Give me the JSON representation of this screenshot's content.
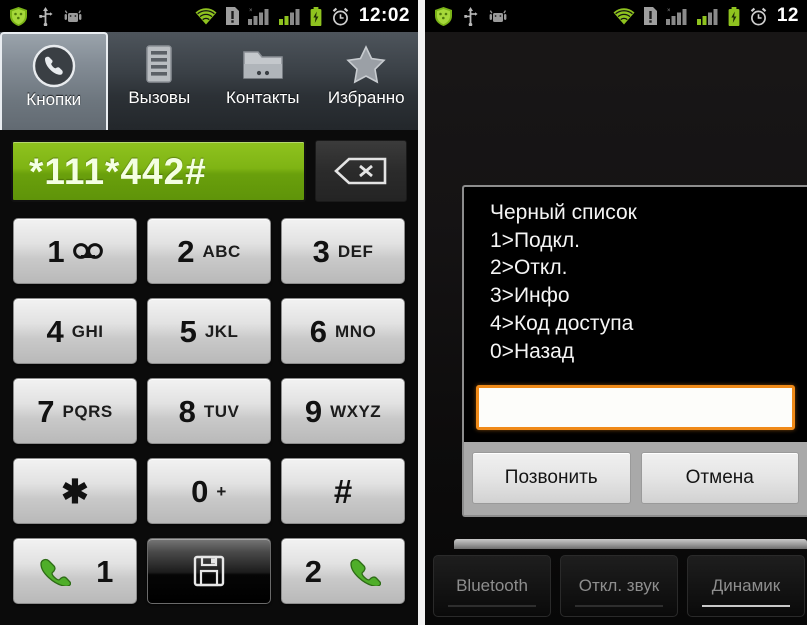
{
  "left_panel": {
    "statusbar": {
      "left_icons": [
        "shield-icon",
        "usb-icon",
        "android-debug-icon"
      ],
      "right_icons": [
        "wifi-icon",
        "sim-alert-icon",
        "signal-bars-gray-icon",
        "signal-bars-green-icon",
        "battery-icon",
        "alarm-clock-icon"
      ],
      "clock": "12:02"
    },
    "tabs": [
      {
        "label": "Кнопки",
        "icon": "phone-handset-icon",
        "active": true
      },
      {
        "label": "Вызовы",
        "icon": "call-log-list-icon",
        "active": false
      },
      {
        "label": "Контакты",
        "icon": "contacts-folder-icon",
        "active": false
      },
      {
        "label": "Избранно",
        "icon": "star-icon",
        "active": false
      }
    ],
    "dialer": {
      "entered_number": "*111*442#",
      "backspace_icon": "backspace-icon"
    },
    "keypad": [
      {
        "num": "1",
        "sub": "",
        "symbol": "",
        "icon": "voicemail-icon",
        "style": "light"
      },
      {
        "num": "2",
        "sub": "ABC",
        "symbol": "",
        "icon": "",
        "style": "light"
      },
      {
        "num": "3",
        "sub": "DEF",
        "symbol": "",
        "icon": "",
        "style": "light"
      },
      {
        "num": "4",
        "sub": "GHI",
        "symbol": "",
        "icon": "",
        "style": "light"
      },
      {
        "num": "5",
        "sub": "JKL",
        "symbol": "",
        "icon": "",
        "style": "light"
      },
      {
        "num": "6",
        "sub": "MNO",
        "symbol": "",
        "icon": "",
        "style": "light"
      },
      {
        "num": "7",
        "sub": "PQRS",
        "symbol": "",
        "icon": "",
        "style": "light"
      },
      {
        "num": "8",
        "sub": "TUV",
        "symbol": "",
        "icon": "",
        "style": "light"
      },
      {
        "num": "9",
        "sub": "WXYZ",
        "symbol": "",
        "icon": "",
        "style": "light"
      },
      {
        "num": "",
        "sub": "",
        "symbol": "✱",
        "icon": "",
        "style": "light"
      },
      {
        "num": "0",
        "sub": "+",
        "symbol": "",
        "icon": "",
        "style": "light"
      },
      {
        "num": "",
        "sub": "",
        "symbol": "#",
        "icon": "",
        "style": "light"
      }
    ],
    "action_row": {
      "call_sim1_label": "1",
      "call_sim1_icon": "green-handset-icon",
      "save_icon": "floppy-save-icon",
      "call_sim2_label": "2",
      "call_sim2_icon": "green-handset-icon"
    }
  },
  "right_panel": {
    "statusbar": {
      "left_icons": [
        "shield-icon",
        "usb-icon",
        "android-debug-icon"
      ],
      "right_icons": [
        "wifi-icon",
        "sim-alert-icon",
        "signal-bars-gray-icon",
        "signal-bars-green-icon",
        "battery-icon",
        "alarm-clock-icon"
      ],
      "clock": "12"
    },
    "ussd_dialog": {
      "lines": [
        "Черный список",
        "1>Подкл.",
        "2>Откл.",
        "3>Инфо",
        "4>Код доступа",
        "0>Назад"
      ],
      "input_value": "",
      "input_placeholder": "",
      "buttons": [
        {
          "label": "Позвонить"
        },
        {
          "label": "Отмена"
        }
      ]
    },
    "call_controls": [
      {
        "label": "Bluetooth",
        "active": false
      },
      {
        "label": "Откл. звук",
        "active": false
      },
      {
        "label": "Динамик",
        "active": true
      }
    ]
  },
  "colors": {
    "dialer_green": "#7fb414",
    "input_focus_orange": "#f08a18",
    "status_green": "#8fc31f",
    "divider_white": "#f2f2f2"
  }
}
